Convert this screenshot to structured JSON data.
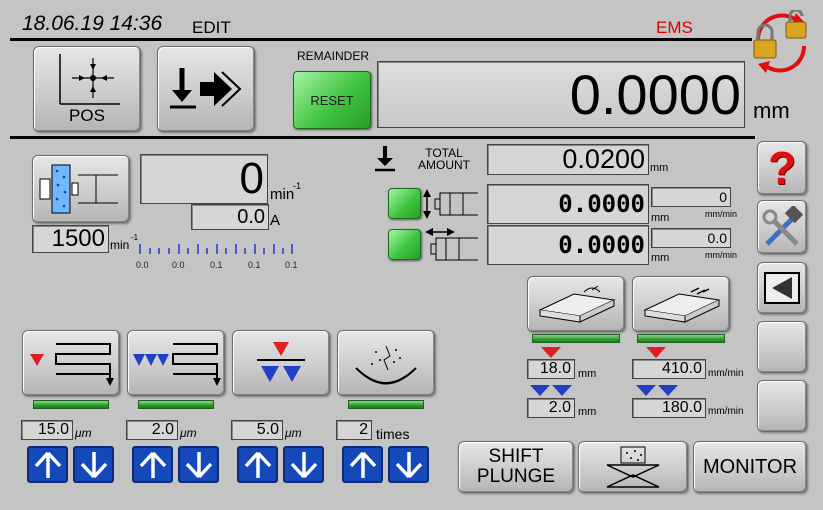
{
  "header": {
    "datetime": "18.06.19 14:36",
    "mode": "EDIT",
    "status": "EMS"
  },
  "buttons": {
    "pos": "POS",
    "reset": "RESET",
    "shift_plunge_l1": "SHIFT",
    "shift_plunge_l2": "PLUNGE",
    "monitor": "MONITOR",
    "help": "?"
  },
  "remainder": {
    "label": "REMAINDER",
    "value": "0.0000",
    "unit": "mm"
  },
  "spindle": {
    "rpm": "0",
    "rpm_unit": "min",
    "rpm_sup": "-1",
    "current": "0.0",
    "current_unit": "A",
    "set_rpm": "1500",
    "set_unit": "min",
    "set_sup": "-1",
    "scale_labels": [
      "0.0",
      "0.0",
      "0.1",
      "0.1",
      "0.1"
    ]
  },
  "total": {
    "label_l1": "TOTAL",
    "label_l2": "AMOUNT",
    "value": "0.0200",
    "unit": "mm"
  },
  "axis1": {
    "pos": "0.0000",
    "pos_unit": "mm",
    "speed": "0",
    "speed_unit": "mm/min"
  },
  "axis2": {
    "pos": "0.0000",
    "pos_unit": "mm",
    "speed": "0.0",
    "speed_unit": "mm/min"
  },
  "dress": {
    "left_red": "18.0",
    "left_red_unit": "mm",
    "left_blue": "2.0",
    "left_blue_unit": "mm",
    "right_red": "410.0",
    "right_red_unit": "mm/min",
    "right_blue": "180.0",
    "right_blue_unit": "mm/min"
  },
  "cycles": [
    {
      "value": "15.0",
      "unit": "μm"
    },
    {
      "value": "2.0",
      "unit": "μm"
    },
    {
      "value": "5.0",
      "unit": "μm"
    },
    {
      "value": "2",
      "unit": "times"
    }
  ],
  "colors": {
    "accent_red": "#e02020",
    "accent_blue": "#2040c8",
    "green": "#2e9b2e",
    "status_red": "#e00000"
  }
}
